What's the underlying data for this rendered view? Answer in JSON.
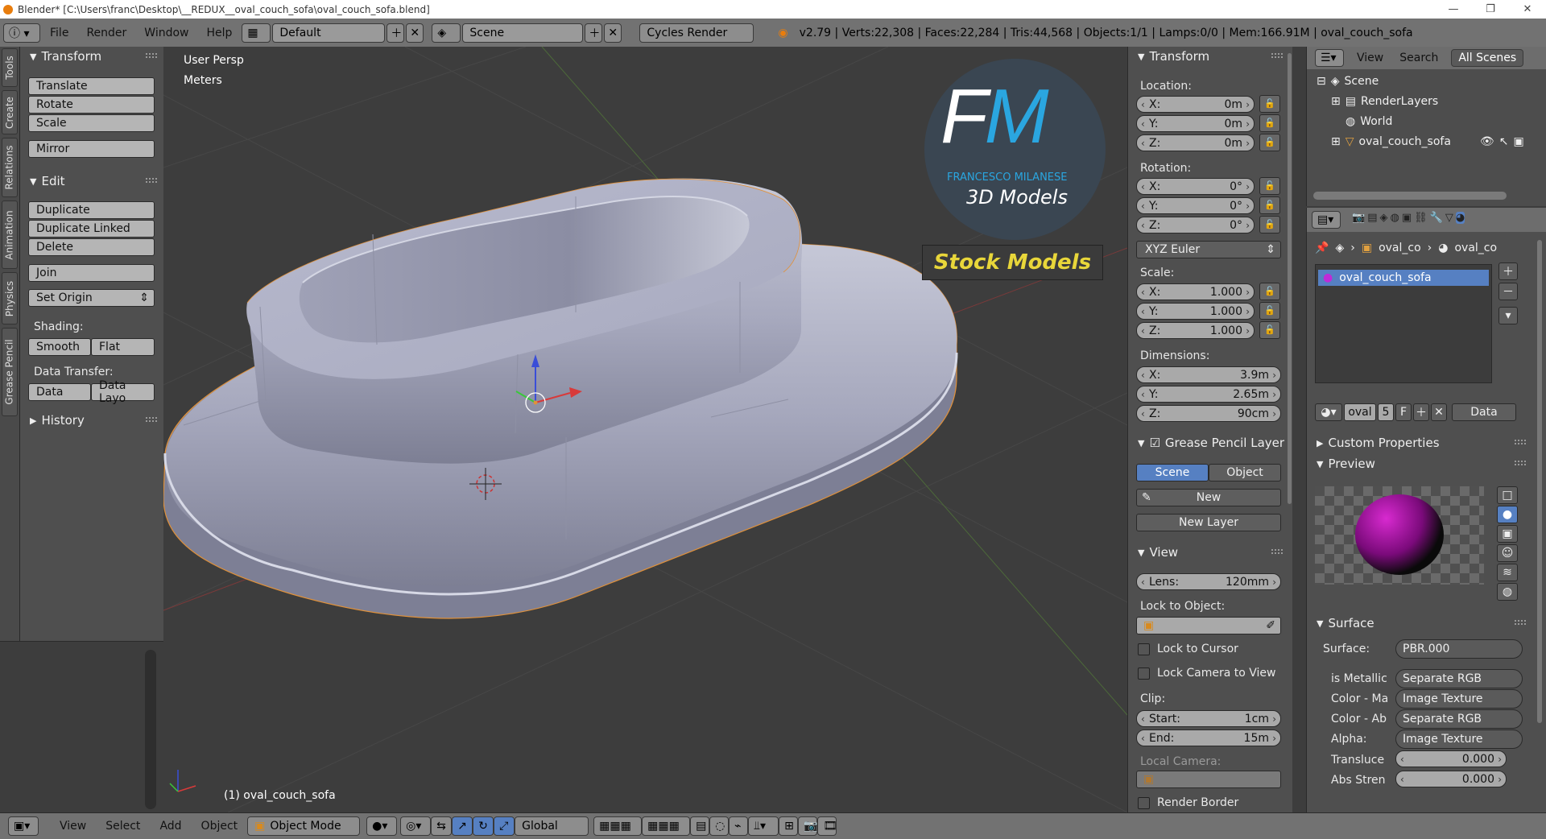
{
  "window": {
    "title": "Blender* [C:\\Users\\franc\\Desktop\\__REDUX__oval_couch_sofa\\oval_couch_sofa.blend]",
    "minimize": "—",
    "maximize": "❐",
    "close": "✕"
  },
  "menu": {
    "file": "File",
    "render": "Render",
    "window": "Window",
    "help": "Help"
  },
  "info": {
    "layout": "Default",
    "scene": "Scene",
    "engine": "Cycles Render",
    "stats": "v2.79 | Verts:22,308 | Faces:22,284 | Tris:44,568 | Objects:1/1 | Lamps:0/0 | Mem:166.91M | oval_couch_sofa"
  },
  "tabs": [
    "Tools",
    "Create",
    "Relations",
    "Animation",
    "Physics",
    "Grease Pencil"
  ],
  "toolshelf": {
    "transform_title": "Transform",
    "translate": "Translate",
    "rotate": "Rotate",
    "scale": "Scale",
    "mirror": "Mirror",
    "edit_title": "Edit",
    "duplicate": "Duplicate",
    "duplicate_linked": "Duplicate Linked",
    "delete": "Delete",
    "join": "Join",
    "set_origin": "Set Origin",
    "shading_label": "Shading:",
    "smooth": "Smooth",
    "flat": "Flat",
    "data_transfer_label": "Data Transfer:",
    "data": "Data",
    "data_layout": "Data Layo",
    "history_title": "History"
  },
  "viewport": {
    "view_name": "User Persp",
    "units": "Meters",
    "object_label": "(1) oval_couch_sofa"
  },
  "watermark": {
    "logo": "FM",
    "author": "FRANCESCO MILANESE",
    "subtitle": "3D Models",
    "banner": "Stock Models"
  },
  "npanel": {
    "transform_title": "Transform",
    "location_label": "Location:",
    "rotation_label": "Rotation:",
    "scale_label": "Scale:",
    "dimensions_label": "Dimensions:",
    "loc": [
      {
        "axis": "X:",
        "value": "0m"
      },
      {
        "axis": "Y:",
        "value": "0m"
      },
      {
        "axis": "Z:",
        "value": "0m"
      }
    ],
    "rot": [
      {
        "axis": "X:",
        "value": "0°"
      },
      {
        "axis": "Y:",
        "value": "0°"
      },
      {
        "axis": "Z:",
        "value": "0°"
      }
    ],
    "rotation_mode": "XYZ Euler",
    "scale": [
      {
        "axis": "X:",
        "value": "1.000"
      },
      {
        "axis": "Y:",
        "value": "1.000"
      },
      {
        "axis": "Z:",
        "value": "1.000"
      }
    ],
    "dims": [
      {
        "axis": "X:",
        "value": "3.9m"
      },
      {
        "axis": "Y:",
        "value": "2.65m"
      },
      {
        "axis": "Z:",
        "value": "90cm"
      }
    ],
    "gp_title": "Grease Pencil Layer",
    "gp_scene": "Scene",
    "gp_object": "Object",
    "gp_new": "New",
    "gp_new_layer": "New Layer",
    "view_title": "View",
    "lens_label": "Lens:",
    "lens_value": "120mm",
    "lock_object_label": "Lock to Object:",
    "lock_cursor": "Lock to Cursor",
    "lock_camera": "Lock Camera to View",
    "clip_label": "Clip:",
    "clip_start_label": "Start:",
    "clip_start": "1cm",
    "clip_end_label": "End:",
    "clip_end": "15m",
    "local_camera_label": "Local Camera:",
    "render_border": "Render Border"
  },
  "outliner": {
    "view": "View",
    "search": "Search",
    "filter": "All Scenes",
    "scene": "Scene",
    "renderlayers": "RenderLayers",
    "world": "World",
    "object": "oval_couch_sofa"
  },
  "properties": {
    "crumb1": "oval_co",
    "crumb2": "oval_co",
    "material_slot": "oval_couch_sofa",
    "mat_name": "oval",
    "users": "5",
    "fake": "F",
    "link": "Data",
    "custom_props": "Custom Properties",
    "preview": "Preview",
    "surface_title": "Surface",
    "surface_label": "Surface:",
    "surface_value": "PBR.000",
    "inputs": [
      {
        "label": "is Metallic",
        "value": "Separate RGB"
      },
      {
        "label": "Color - Ma",
        "value": "Image Texture"
      },
      {
        "label": "Color - Ab",
        "value": "Separate RGB"
      },
      {
        "label": "Alpha:",
        "value": "Image Texture"
      }
    ],
    "transl_label": "Transluce",
    "transl_value": "0.000",
    "abs_label": "Abs Stren",
    "abs_value": "0.000"
  },
  "bottom": {
    "view": "View",
    "select": "Select",
    "add": "Add",
    "object": "Object",
    "mode": "Object Mode",
    "orientation": "Global"
  },
  "colors": {
    "selected_blue": "#5680c2",
    "header": "#727272",
    "panel": "#4f4f4f",
    "viewport": "#3d3d3d"
  }
}
